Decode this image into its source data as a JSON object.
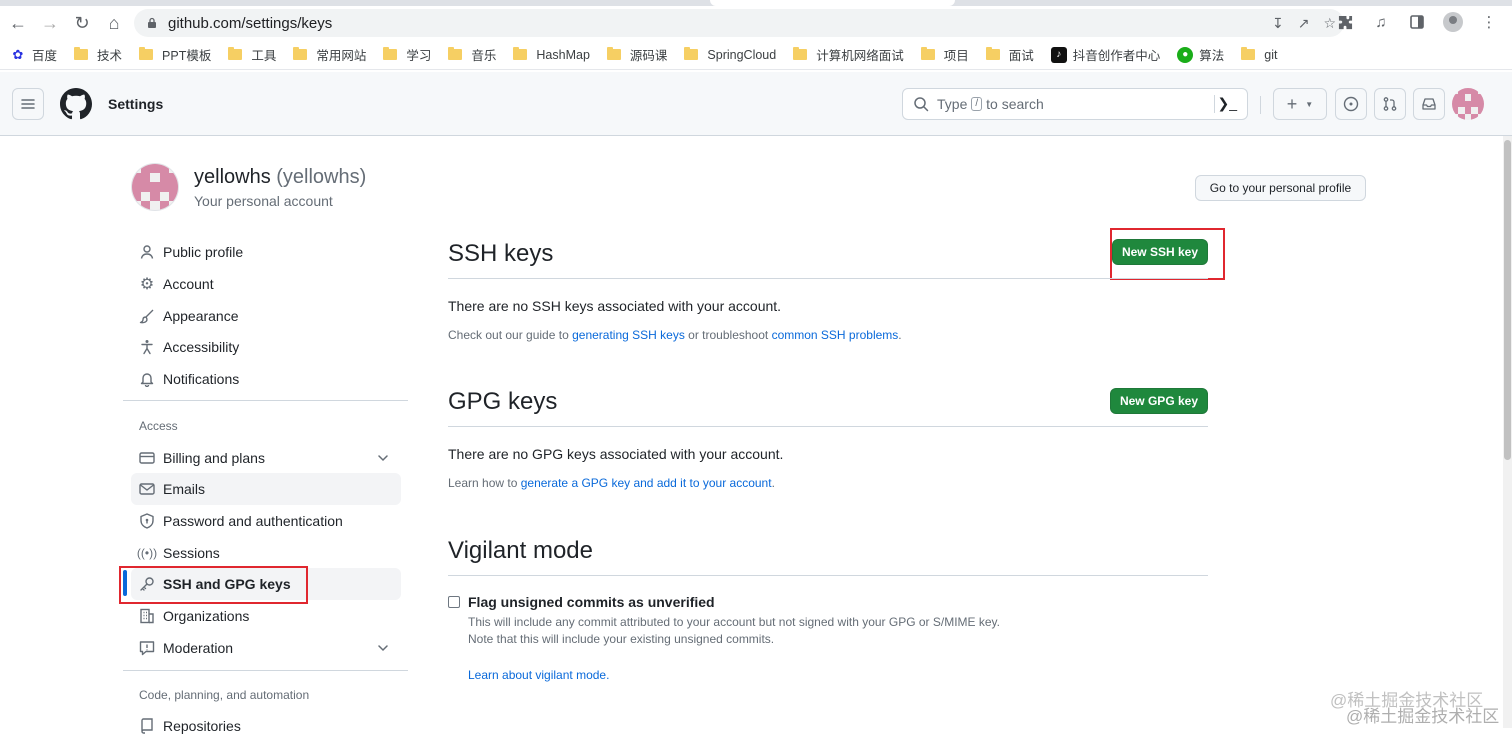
{
  "browser": {
    "url": "github.com/settings/keys",
    "bookmarks": [
      {
        "label": "百度",
        "icon": "baidu-icon"
      },
      {
        "label": "技术",
        "icon": "folder-icon"
      },
      {
        "label": "PPT模板",
        "icon": "folder-icon"
      },
      {
        "label": "工具",
        "icon": "folder-icon"
      },
      {
        "label": "常用网站",
        "icon": "folder-icon"
      },
      {
        "label": "学习",
        "icon": "folder-icon"
      },
      {
        "label": "音乐",
        "icon": "folder-icon"
      },
      {
        "label": "HashMap",
        "icon": "folder-icon"
      },
      {
        "label": "源码课",
        "icon": "folder-icon"
      },
      {
        "label": "SpringCloud",
        "icon": "folder-icon"
      },
      {
        "label": "计算机网络面试",
        "icon": "folder-icon"
      },
      {
        "label": "项目",
        "icon": "folder-icon"
      },
      {
        "label": "面试",
        "icon": "folder-icon"
      },
      {
        "label": "抖音创作者中心",
        "icon": "douyin-icon"
      },
      {
        "label": "算法",
        "icon": "wechat-icon"
      },
      {
        "label": "git",
        "icon": "folder-icon"
      }
    ]
  },
  "header": {
    "context": "Settings",
    "search_placeholder_before": "Type",
    "search_key": "/",
    "search_placeholder_after": "to search"
  },
  "account": {
    "name": "yellowhs",
    "login": "(yellowhs)",
    "subtitle": "Your personal account",
    "profile_button": "Go to your personal profile"
  },
  "sidebar": {
    "items": [
      {
        "label": "Public profile",
        "icon": "person-icon"
      },
      {
        "label": "Account",
        "icon": "gear-icon"
      },
      {
        "label": "Appearance",
        "icon": "paintbrush-icon"
      },
      {
        "label": "Accessibility",
        "icon": "accessibility-icon"
      },
      {
        "label": "Notifications",
        "icon": "bell-icon"
      }
    ],
    "access_heading": "Access",
    "access_items": [
      {
        "label": "Billing and plans",
        "icon": "credit-card-icon",
        "expandable": true
      },
      {
        "label": "Emails",
        "icon": "mail-icon"
      },
      {
        "label": "Password and authentication",
        "icon": "shield-lock-icon"
      },
      {
        "label": "Sessions",
        "icon": "broadcast-icon"
      },
      {
        "label": "SSH and GPG keys",
        "icon": "key-icon",
        "active": true
      },
      {
        "label": "Organizations",
        "icon": "organization-icon"
      },
      {
        "label": "Moderation",
        "icon": "report-icon",
        "expandable": true
      }
    ],
    "code_heading": "Code, planning, and automation",
    "code_items": [
      {
        "label": "Repositories",
        "icon": "repo-icon"
      }
    ]
  },
  "main": {
    "ssh": {
      "title": "SSH keys",
      "button": "New SSH key",
      "empty": "There are no SSH keys associated with your account.",
      "guide_prefix": "Check out our guide to",
      "guide_link1": "generating SSH keys",
      "guide_middle": "or troubleshoot",
      "guide_link2": "common SSH problems",
      "guide_suffix": "."
    },
    "gpg": {
      "title": "GPG keys",
      "button": "New GPG key",
      "empty": "There are no GPG keys associated with your account.",
      "learn_prefix": "Learn how to",
      "learn_link": "generate a GPG key and add it to your account",
      "learn_suffix": "."
    },
    "vigilant": {
      "title": "Vigilant mode",
      "checkbox_label": "Flag unsigned commits as unverified",
      "checked": false,
      "note1": "This will include any commit attributed to your account but not signed with your GPG or S/MIME key.",
      "note2": "Note that this will include your existing unsigned commits.",
      "learn_link": "Learn about vigilant mode."
    }
  },
  "watermark": "@稀土掘金技术社区",
  "colors": {
    "primary_button": "#1f883d",
    "link": "#0969da",
    "active_indicator": "#0969da",
    "highlight_box": "#e0272f",
    "identicon": "#d68aa7"
  }
}
